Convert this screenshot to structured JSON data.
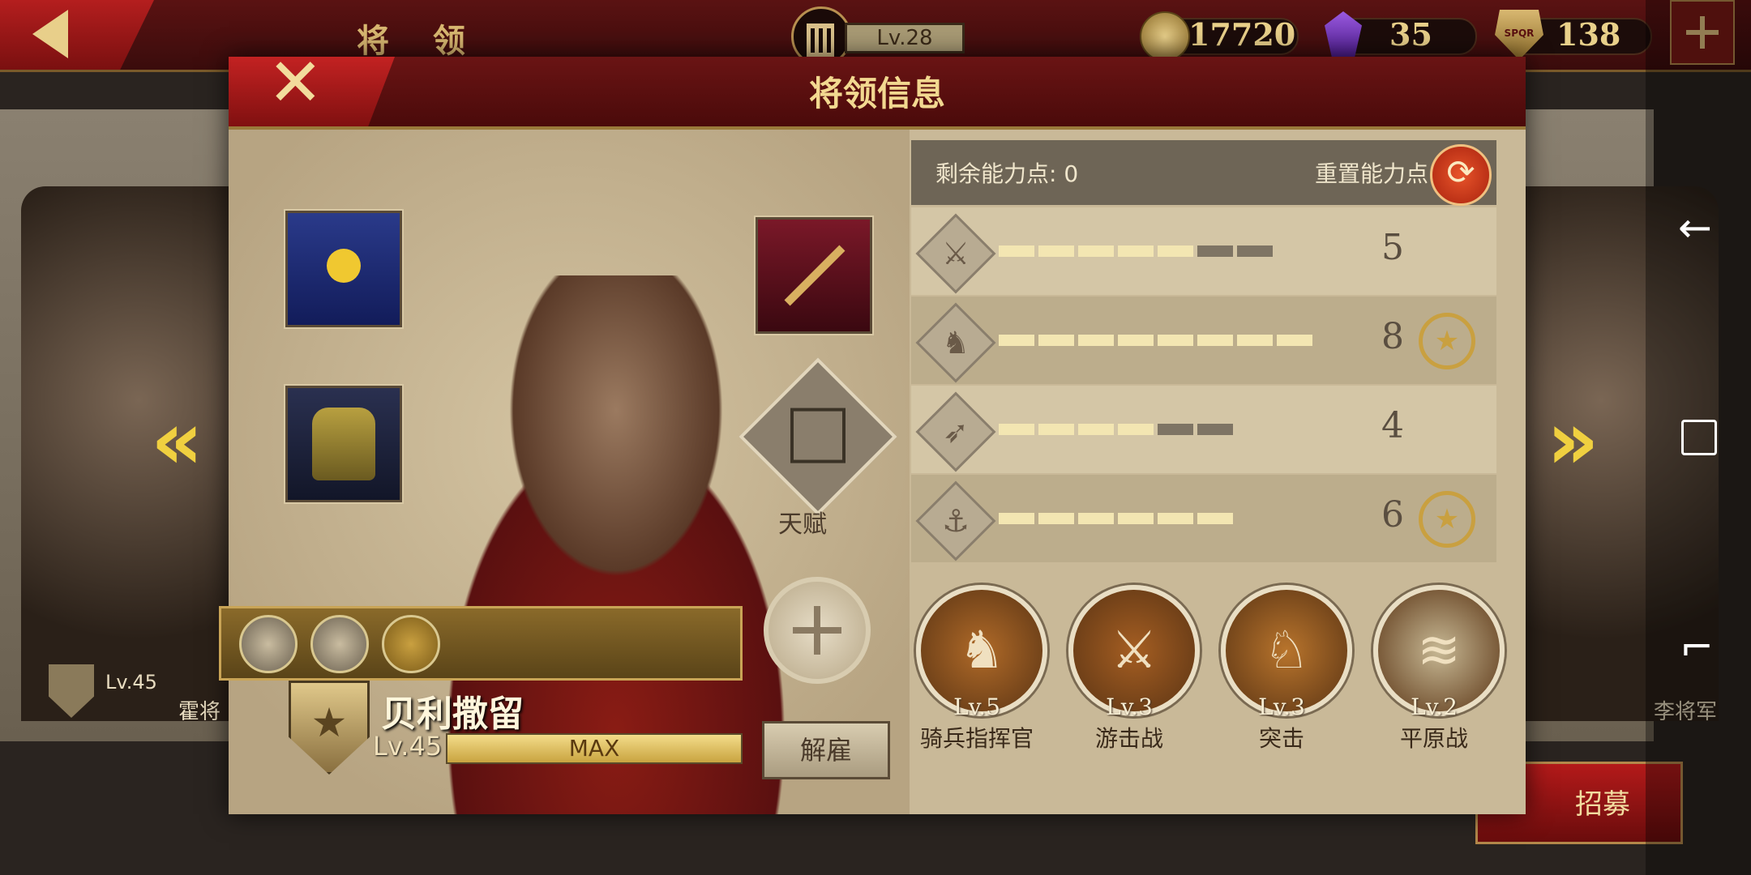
{
  "topbar": {
    "title": "将 领",
    "player_level": "Lv.28",
    "gold": "17720",
    "gems": "35",
    "tokens": "138",
    "token_icon_text": "SPQR"
  },
  "panel": {
    "title": "将领信息",
    "close_label": "✕",
    "remaining_points_label": "剩余能力点: 0",
    "reset_label": "重置能力点",
    "talent_label": "天赋",
    "dismiss_label": "解雇"
  },
  "hero": {
    "name": "贝利撒留",
    "level": "Lv.45",
    "xp_label": "MAX"
  },
  "stats": [
    {
      "icon": "sword-icon",
      "glyph": "⚔",
      "value": "5",
      "filled": 5,
      "total": 7,
      "laurel": false
    },
    {
      "icon": "horse-icon",
      "glyph": "♞",
      "value": "8",
      "filled": 8,
      "total": 8,
      "laurel": true
    },
    {
      "icon": "bow-icon",
      "glyph": "➶",
      "value": "4",
      "filled": 4,
      "total": 6,
      "laurel": false
    },
    {
      "icon": "anchor-icon",
      "glyph": "⚓",
      "value": "6",
      "filled": 6,
      "total": 6,
      "laurel": true
    }
  ],
  "skills": [
    {
      "level": "Lv.5",
      "name": "骑兵指挥官",
      "glyph": "♞",
      "color": "#b06a28"
    },
    {
      "level": "Lv.3",
      "name": "游击战",
      "glyph": "⚔",
      "color": "#a55e22"
    },
    {
      "level": "Lv.3",
      "name": "突击",
      "glyph": "♘",
      "color": "#b8742c"
    },
    {
      "level": "Lv.2",
      "name": "平原战",
      "glyph": "≋",
      "color": "#c7b894"
    }
  ],
  "background": {
    "left_general_level": "Lv.45",
    "left_general_name": "霍将",
    "right_general_name": "李将军",
    "recruit_label": "招募"
  },
  "colors": {
    "accent_gold": "#e9d08a",
    "header_red": "#5a1212",
    "panel_bg": "#c9b998"
  }
}
